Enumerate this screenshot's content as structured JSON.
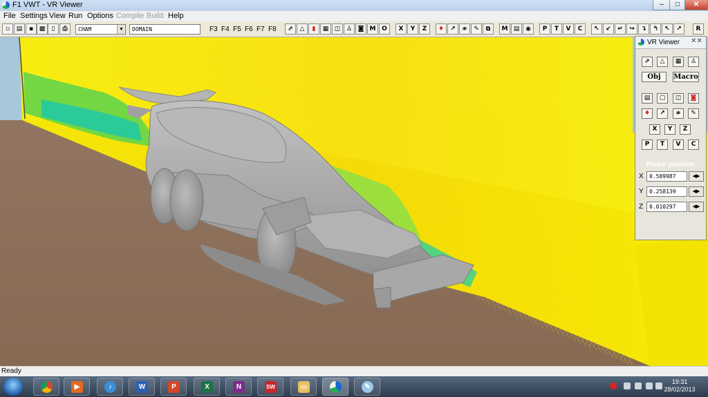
{
  "window": {
    "title": "F1 VWT - VR Viewer",
    "controls": {
      "minimize": "–",
      "maximize": "□",
      "close": "✕"
    }
  },
  "menu": [
    "File",
    "Settings",
    "View",
    "Run",
    "Options",
    "Compile",
    "Build",
    "Help"
  ],
  "menu_disabled": [
    "Compile",
    "Build"
  ],
  "toolbar": {
    "object_combo": "CHAM",
    "domain_combo": "DOMAIN",
    "fkeys": [
      "F3",
      "F4",
      "F5",
      "F6",
      "F7",
      "F8"
    ],
    "axis_buttons": [
      "X",
      "Y",
      "Z"
    ],
    "m_button": "M",
    "o_button": "O",
    "mid_m": "M",
    "ptvc": [
      "P",
      "T",
      "V",
      "C"
    ],
    "r_button": "R"
  },
  "vr_panel": {
    "title": "VR Viewer",
    "close": "✕✕",
    "obj_button": "Obj",
    "macro_button": "Macro",
    "axis_buttons": [
      "X",
      "Y",
      "Z"
    ],
    "ptvc": [
      "P",
      "T",
      "V",
      "C"
    ],
    "probe_title": "Probe position",
    "probe": [
      {
        "label": "X",
        "value": "0.589987"
      },
      {
        "label": "Y",
        "value": "0.258139"
      },
      {
        "label": "Z",
        "value": "0.010297"
      }
    ]
  },
  "status": "Ready",
  "taskbar": {
    "time": "19:31",
    "date": "28/02/2013",
    "apps": [
      "chrome-icon",
      "media-player-icon",
      "itunes-icon",
      "word-icon",
      "powerpoint-icon",
      "excel-icon",
      "onenote-icon",
      "solidworks-icon",
      "explorer-icon",
      "phoenics-icon",
      "paint-icon"
    ],
    "app_glyphs": {
      "word": "W",
      "powerpoint": "P",
      "excel": "X",
      "onenote": "N",
      "solidworks": "SW"
    }
  },
  "colors": {
    "flow_yellow": "#fff200",
    "flow_green": "#6fd34a",
    "flow_cyan": "#18c8b0",
    "ground": "#8b6f58",
    "car": "#a9a9a9"
  }
}
